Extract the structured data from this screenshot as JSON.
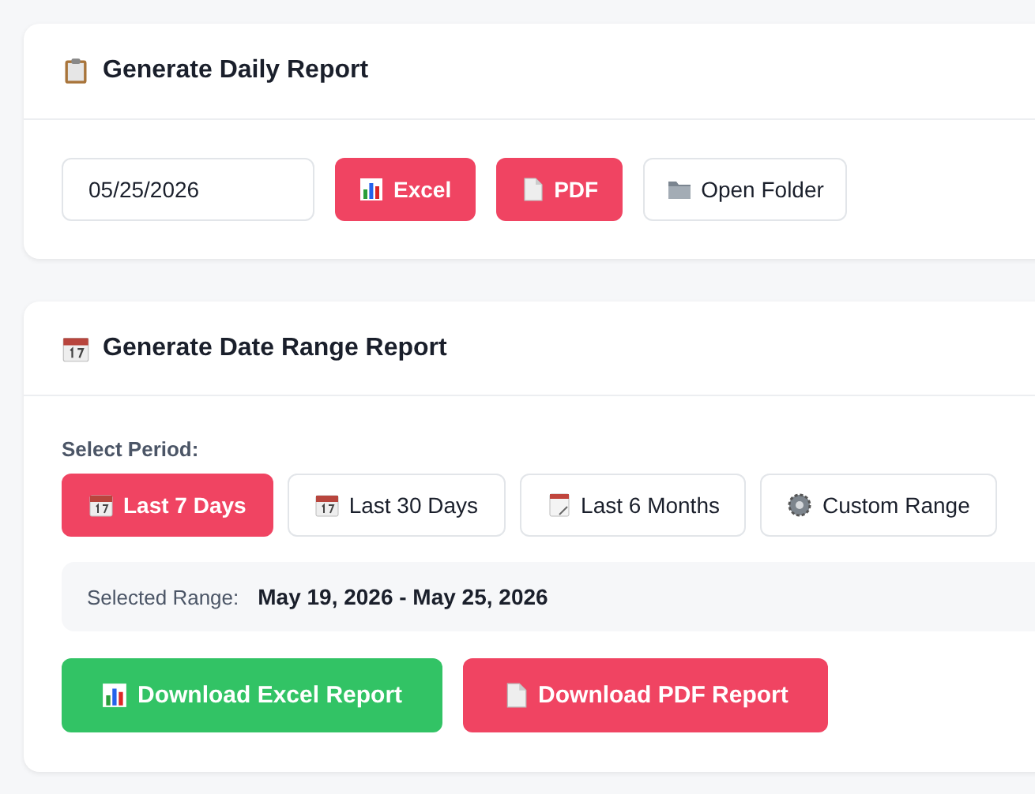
{
  "daily_report": {
    "title": "Generate Daily Report",
    "date_field": {
      "value": "05/25/2026"
    },
    "buttons": [
      {
        "label": "Excel",
        "kind": "excel"
      },
      {
        "label": "PDF",
        "kind": "pdf"
      },
      {
        "label": "Open Folder",
        "kind": "folder"
      }
    ]
  },
  "range_report": {
    "title": "Generate Date Range Report",
    "period_label": "Select Period:",
    "periods": [
      {
        "label": "Last 7 Days",
        "selected": true
      },
      {
        "label": "Last 30 Days",
        "selected": false
      },
      {
        "label": "Last 6 Months",
        "selected": false
      },
      {
        "label": "Custom Range",
        "selected": false
      }
    ],
    "selected_range": {
      "label": "Selected Range:",
      "value": "May 19, 2026 - May 25, 2026"
    },
    "downloads": [
      {
        "label": "Download Excel Report",
        "kind": "excel"
      },
      {
        "label": "Download PDF Report",
        "kind": "pdf"
      }
    ]
  }
}
